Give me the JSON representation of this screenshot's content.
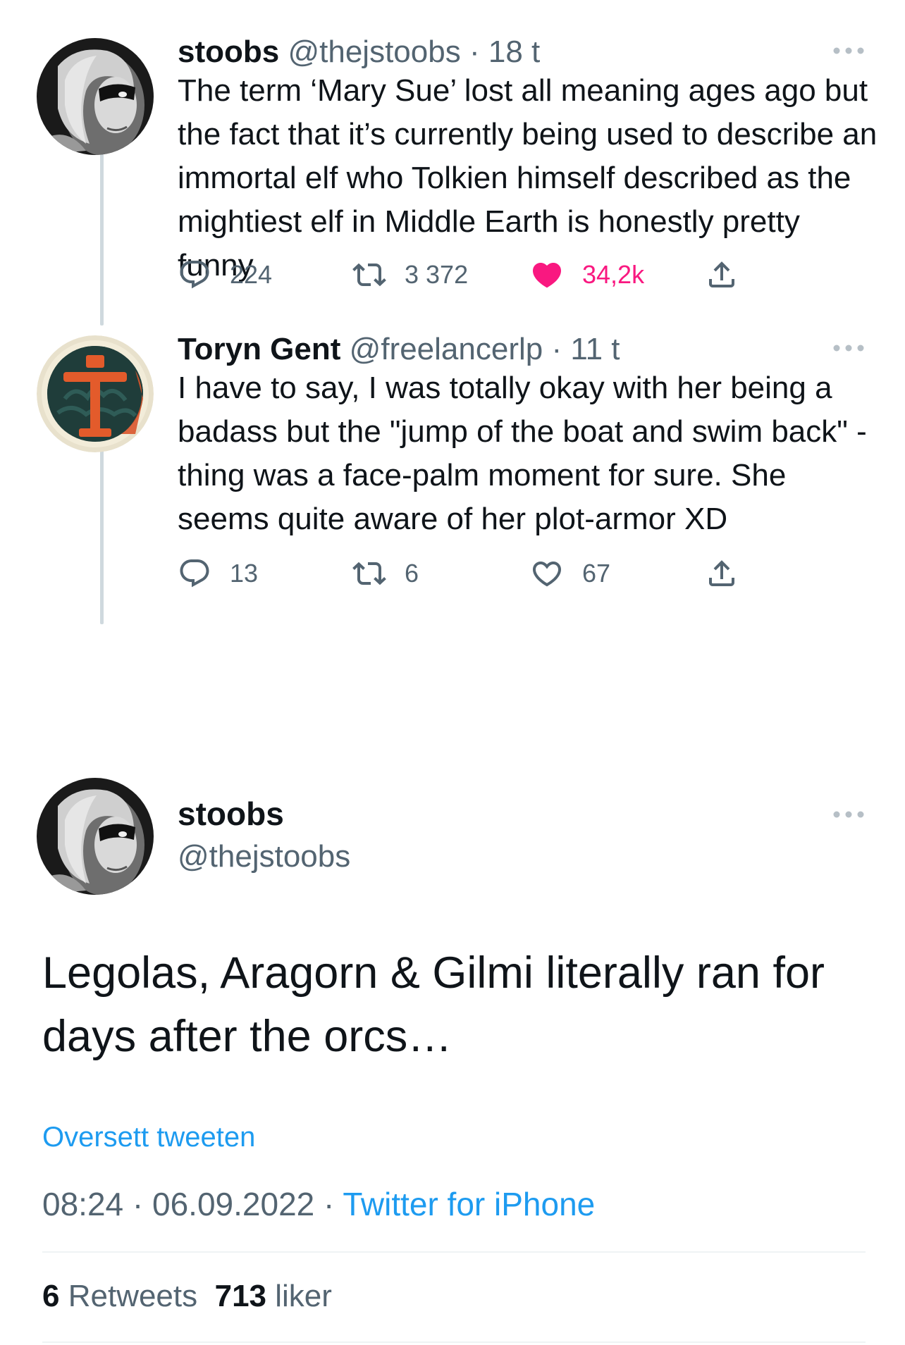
{
  "tweets": [
    {
      "name": "stoobs",
      "handle": "@thejstoobs",
      "separator": "·",
      "time": "18 t",
      "text": "The term ‘Mary Sue’ lost all meaning ages ago but the fact that it’s currently being used to describe an immortal elf who Tolkien himself described as the mightiest elf in Middle Earth is honestly pretty funny",
      "replies": "224",
      "retweets": "3 372",
      "likes": "34,2k",
      "liked": true
    },
    {
      "name": "Toryn Gent",
      "handle": "@freelancerlp",
      "separator": "·",
      "time": "11 t",
      "text": "I have to say, I was totally okay with her being a badass but the \"jump of the boat and swim back\" - thing was a face-palm moment for sure. She seems quite aware of her plot-armor XD",
      "replies": "13",
      "retweets": "6",
      "likes": "67",
      "liked": false
    }
  ],
  "focused": {
    "name": "stoobs",
    "handle": "@thejstoobs",
    "text": "Legolas, Aragorn & Gilmi literally ran for days after the orcs…",
    "translate_label": "Oversett tweeten",
    "time": "08:24",
    "separator": "·",
    "date": "06.09.2022",
    "source": "Twitter for iPhone",
    "retweet_count": "6",
    "retweet_label": "Retweets",
    "like_count": "713",
    "like_label": "liker"
  },
  "colors": {
    "accent": "#1d9bf0",
    "like": "#f91880",
    "secondary_text": "#536471",
    "thread_line": "#cfd9de"
  },
  "icons": {
    "reply": "reply-icon",
    "retweet": "retweet-icon",
    "like": "heart-icon",
    "share": "share-icon",
    "more": "more-icon"
  }
}
